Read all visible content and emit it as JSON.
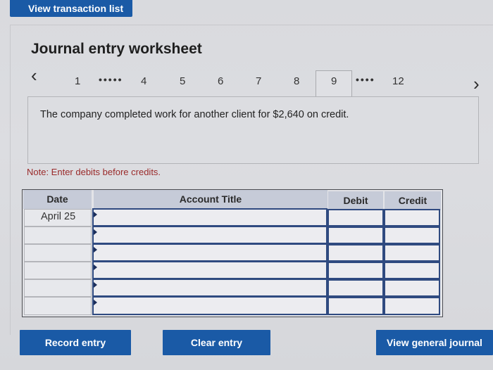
{
  "top_button": {
    "label": "View transaction list"
  },
  "worksheet": {
    "title": "Journal entry worksheet"
  },
  "pager": {
    "prev_icon": "chevron-left-icon",
    "next_icon": "chevron-right-icon",
    "items": [
      "1",
      "4",
      "5",
      "6",
      "7",
      "8",
      "9",
      "12"
    ],
    "ellipsis_after_1": "•••••",
    "ellipsis_after_9": "••••",
    "active": "9"
  },
  "question": {
    "text": "The company completed work for another client for $2,640 on credit."
  },
  "note": "Note: Enter debits before credits.",
  "journal": {
    "columns": [
      "Date",
      "Account Title",
      "Debit",
      "Credit"
    ],
    "rows": [
      {
        "date": "April 25",
        "account": "",
        "debit": "",
        "credit": ""
      },
      {
        "date": "",
        "account": "",
        "debit": "",
        "credit": ""
      },
      {
        "date": "",
        "account": "",
        "debit": "",
        "credit": ""
      },
      {
        "date": "",
        "account": "",
        "debit": "",
        "credit": ""
      },
      {
        "date": "",
        "account": "",
        "debit": "",
        "credit": ""
      },
      {
        "date": "",
        "account": "",
        "debit": "",
        "credit": ""
      }
    ]
  },
  "buttons": {
    "record": "Record entry",
    "clear": "Clear entry",
    "view_journal": "View general journal"
  },
  "colors": {
    "brand_button": "#1a5aa6",
    "header_bg": "#c6cbd8",
    "note_text": "#9a2a2a"
  }
}
